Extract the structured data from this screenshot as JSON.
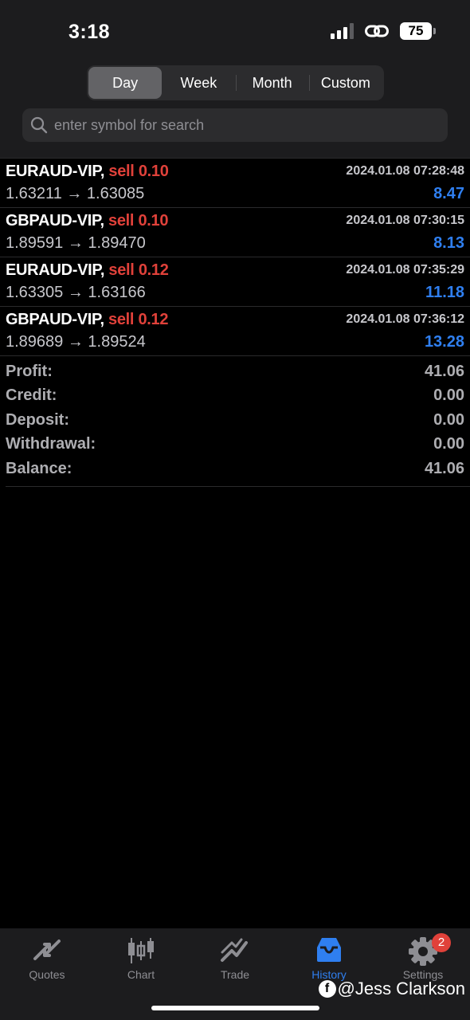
{
  "status_bar": {
    "time": "3:18",
    "battery": "75"
  },
  "period_tabs": [
    {
      "label": "Day",
      "active": true
    },
    {
      "label": "Week",
      "active": false
    },
    {
      "label": "Month",
      "active": false
    },
    {
      "label": "Custom",
      "active": false
    }
  ],
  "search": {
    "placeholder": "enter symbol for search"
  },
  "trades": [
    {
      "symbol": "EURAUD-VIP,",
      "side": "sell 0.10",
      "time": "2024.01.08 07:28:48",
      "prices": "1.63211 → 1.63085",
      "profit": "8.47"
    },
    {
      "symbol": "GBPAUD-VIP,",
      "side": "sell 0.10",
      "time": "2024.01.08 07:30:15",
      "prices": "1.89591 → 1.89470",
      "profit": "8.13"
    },
    {
      "symbol": "EURAUD-VIP,",
      "side": "sell 0.12",
      "time": "2024.01.08 07:35:29",
      "prices": "1.63305 → 1.63166",
      "profit": "11.18"
    },
    {
      "symbol": "GBPAUD-VIP,",
      "side": "sell 0.12",
      "time": "2024.01.08 07:36:12",
      "prices": "1.89689 → 1.89524",
      "profit": "13.28"
    }
  ],
  "summary": [
    {
      "label": "Profit:",
      "value": "41.06"
    },
    {
      "label": "Credit:",
      "value": "0.00"
    },
    {
      "label": "Deposit:",
      "value": "0.00"
    },
    {
      "label": "Withdrawal:",
      "value": "0.00"
    },
    {
      "label": "Balance:",
      "value": "41.06"
    }
  ],
  "tab_bar": [
    {
      "label": "Quotes",
      "icon": "quotes-icon",
      "active": false
    },
    {
      "label": "Chart",
      "icon": "chart-icon",
      "active": false
    },
    {
      "label": "Trade",
      "icon": "trade-icon",
      "active": false
    },
    {
      "label": "History",
      "icon": "history-icon",
      "active": true
    },
    {
      "label": "Settings",
      "icon": "settings-icon",
      "active": false,
      "badge": "2"
    }
  ],
  "watermark": {
    "fb_glyph": "f",
    "text": "@Jess Clarkson"
  },
  "colors": {
    "sell": "#e0413a",
    "profit": "#2f7ff0",
    "active_tab": "#2f7ff0",
    "badge": "#e0413a"
  }
}
